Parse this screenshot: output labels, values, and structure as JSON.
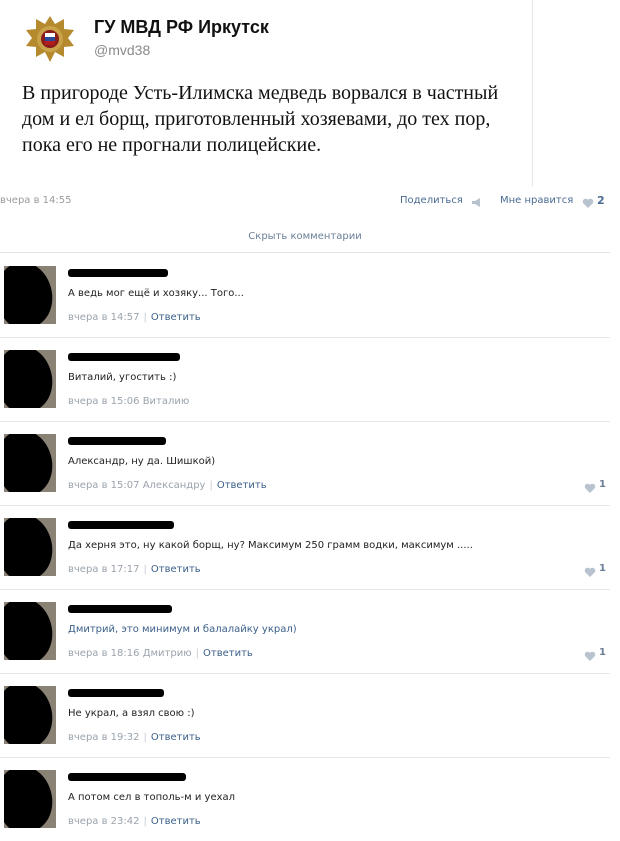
{
  "tweet": {
    "name": "ГУ МВД РФ Иркутск",
    "handle": "@mvd38",
    "text": "В пригороде Усть-Илимска медведь ворвался в частный дом и ел борщ, приготовленный хозяевами, до тех пор, пока его не прогнали полицейские."
  },
  "post": {
    "date": "вчера в 14:55",
    "share_label": "Поделиться",
    "like_label": "Мне нравится",
    "like_count": "2",
    "hide_comments": "Скрыть комментарии"
  },
  "comments": [
    {
      "text": "А ведь мог ещё и хозяку... Того...",
      "time": "вчера в 14:57",
      "reply_to": "",
      "reply_label": "Ответить",
      "likes": ""
    },
    {
      "text": "Виталий, угостить :)",
      "time": "вчера в 15:06",
      "reply_to": "Виталию",
      "reply_label": "",
      "likes": ""
    },
    {
      "text": "Александр, ну да. Шишкой)",
      "time": "вчера в 15:07",
      "reply_to": "Александру",
      "reply_label": "Ответить",
      "likes": "1"
    },
    {
      "text": "Да херня это, ну какой борщ, ну? Максимум 250 грамм водки, максимум .....",
      "time": "вчера в 17:17",
      "reply_to": "",
      "reply_label": "Ответить",
      "likes": "1"
    },
    {
      "text": "Дмитрий, это минимум и балалайку украл)",
      "time": "вчера в 18:16",
      "reply_to": "Дмитрию",
      "reply_label": "Ответить",
      "likes": "1"
    },
    {
      "text": "Не украл, а взял свою :)",
      "time": "вчера в 19:32",
      "reply_to": "",
      "reply_label": "Ответить",
      "likes": ""
    },
    {
      "text": "А потом сел в тополь-м и уехал",
      "time": "вчера в 23:42",
      "reply_to": "",
      "reply_label": "Ответить",
      "likes": ""
    }
  ],
  "colors": {
    "link": "#3b5f8a",
    "muted": "#9aa3ad",
    "redaction": "#000000"
  },
  "icons": [
    "mvd-emblem",
    "megaphone-icon",
    "heart-icon"
  ]
}
